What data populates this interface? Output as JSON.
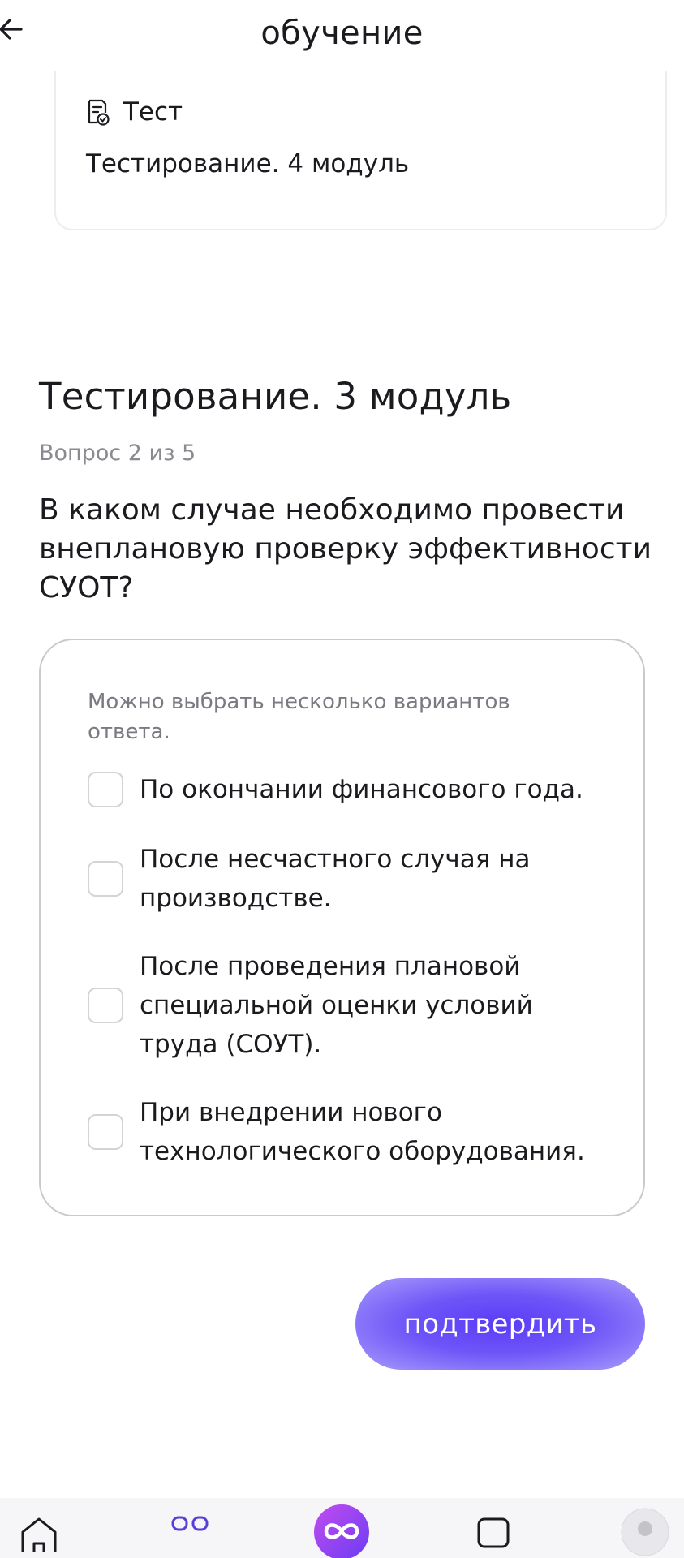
{
  "header": {
    "title": "обучение"
  },
  "prev_card": {
    "type_label": "Тест",
    "name": "Тестирование. 4 модуль"
  },
  "test": {
    "title": "Тестирование. 3 модуль",
    "progress": "Вопрос 2 из 5",
    "question": "В каком случае необходимо провести внеплановую проверку эффективности СУОТ?",
    "hint": "Можно выбрать несколько вариантов ответа.",
    "options": [
      "По окончании финансового года.",
      "После несчастного случая на производстве.",
      "После проведения плановой специальной оценки условий труда (СОУТ).",
      "При внедрении нового технологического оборудования."
    ],
    "confirm_label": "подтвердить"
  },
  "colors": {
    "accent": "#5b3cf6",
    "icon_purple": "#5a3fd6"
  },
  "icons": [
    "arrow-left-icon",
    "document-check-icon",
    "home-icon",
    "courses-icon",
    "assistant-icon",
    "chat-icon",
    "avatar"
  ]
}
